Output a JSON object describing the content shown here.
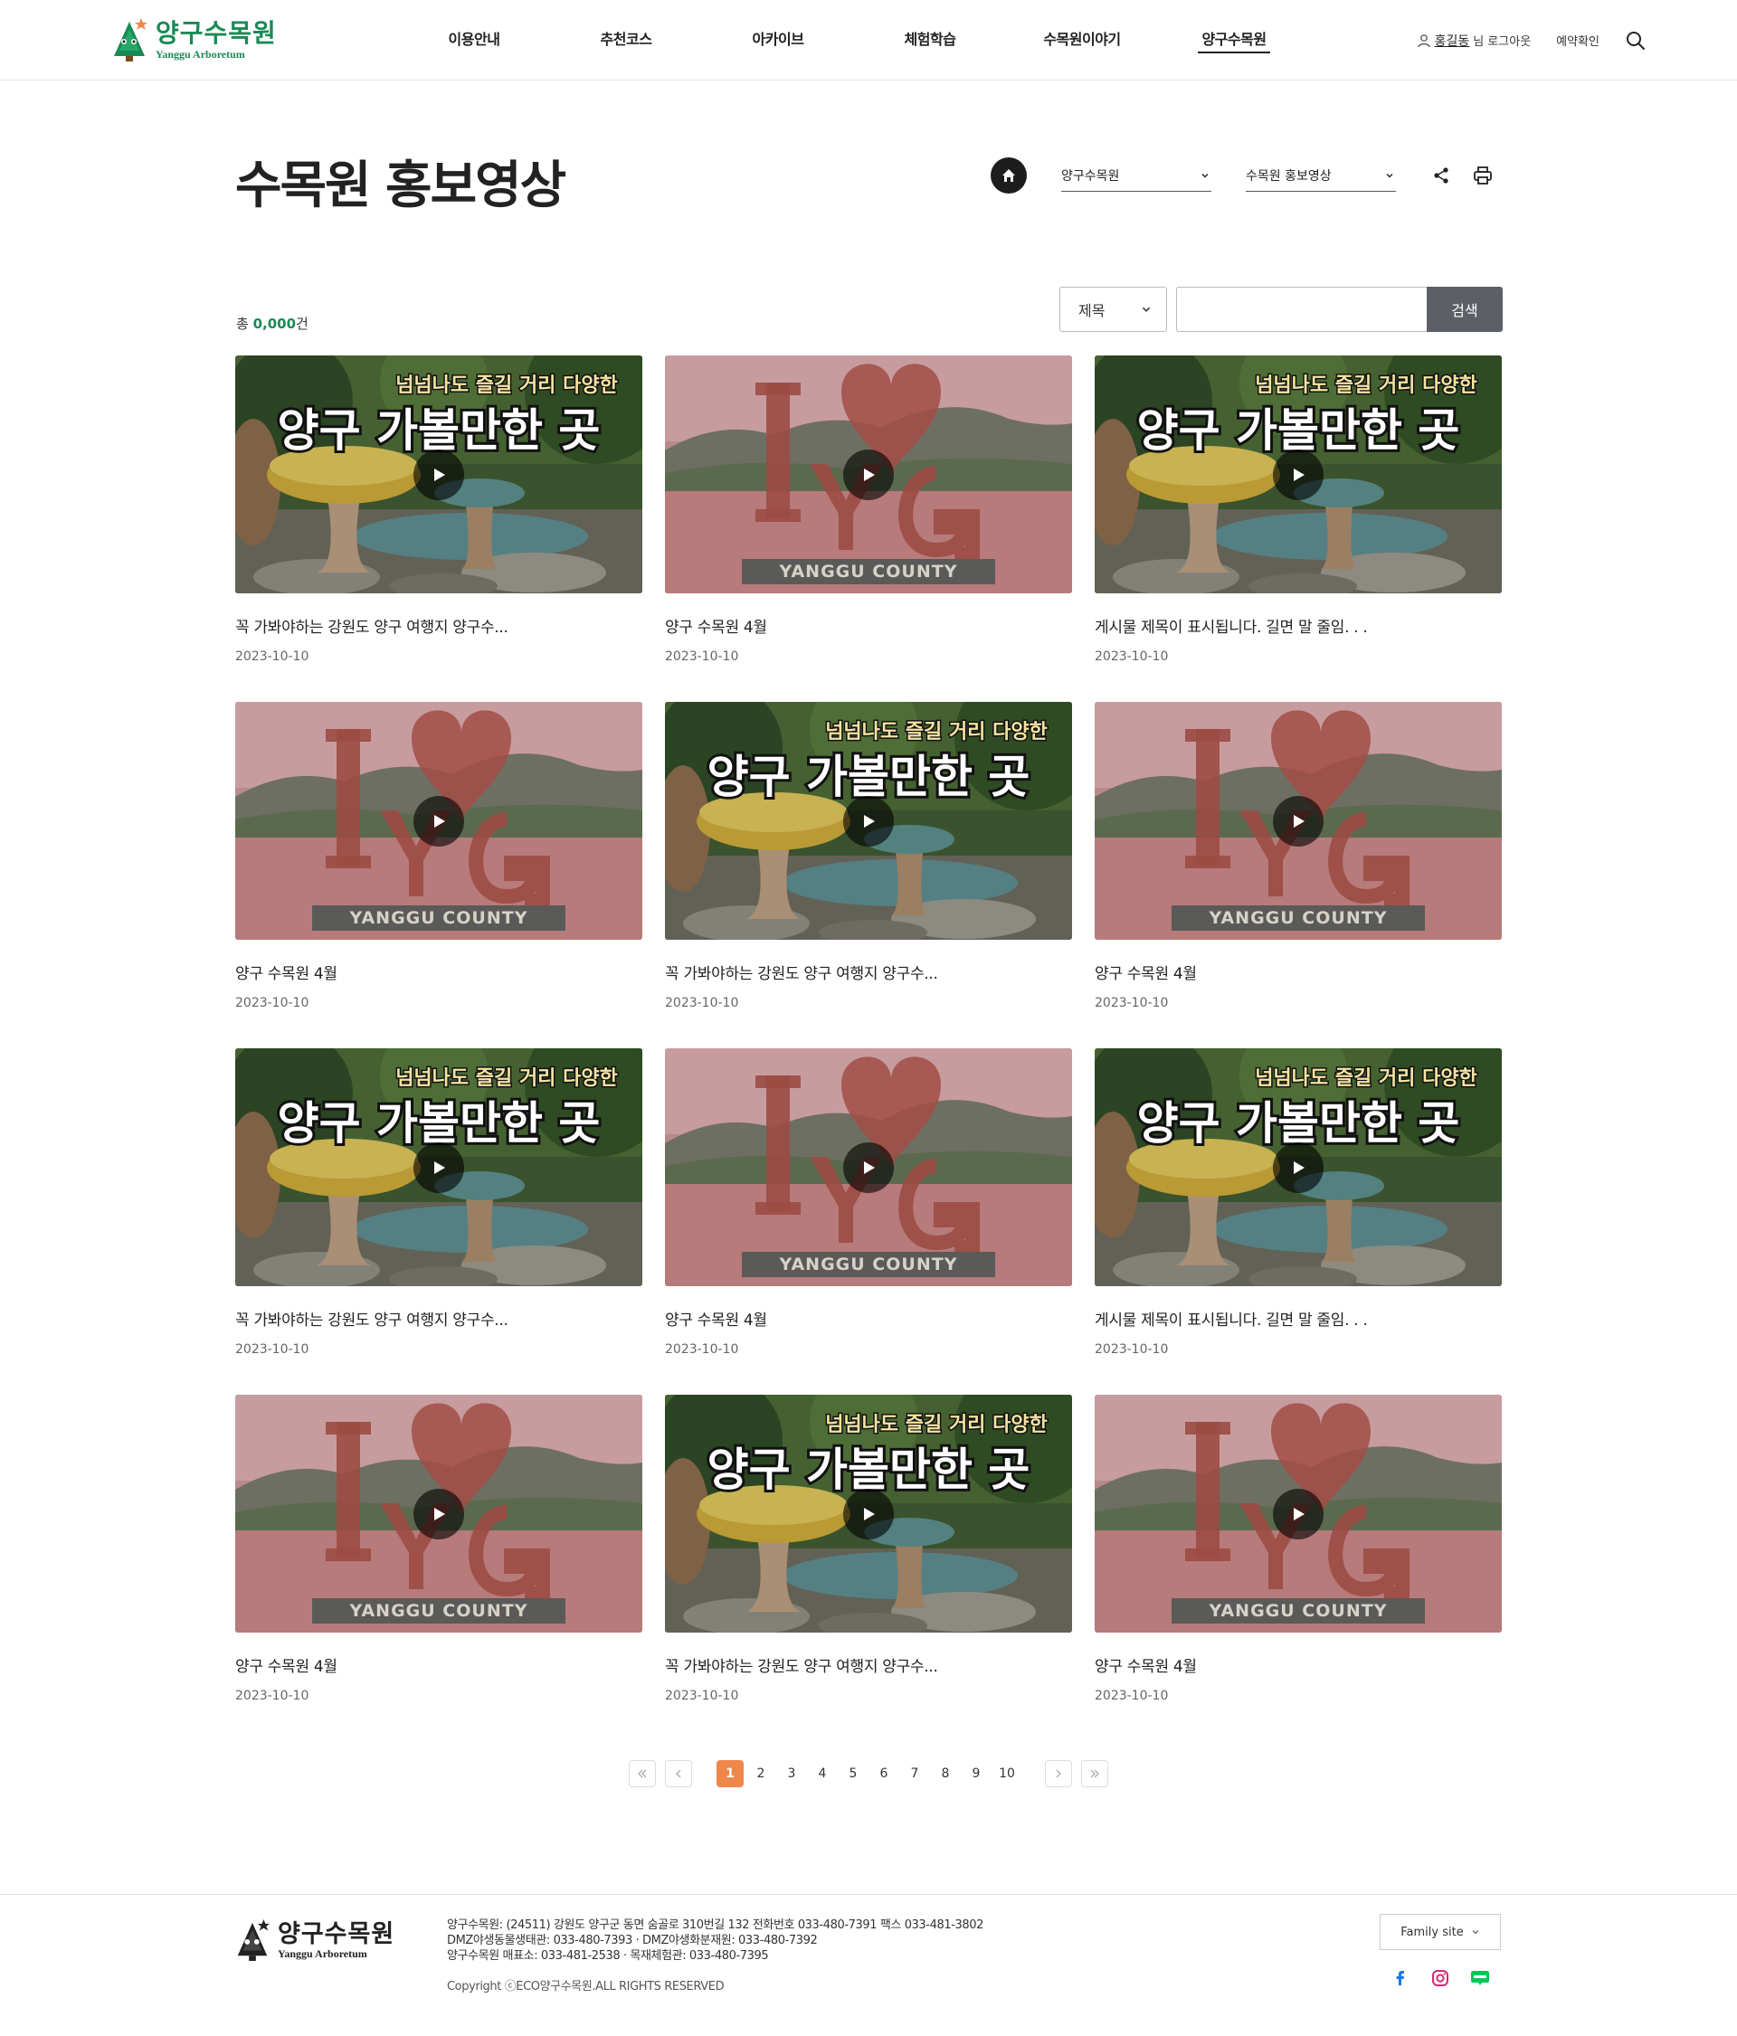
{
  "header": {
    "logo_ko": "양구수목원",
    "logo_en": "Yanggu Arboretum",
    "nav": [
      {
        "label": "이용안내",
        "active": false
      },
      {
        "label": "추천코스",
        "active": false
      },
      {
        "label": "아카이브",
        "active": false
      },
      {
        "label": "체험학습",
        "active": false
      },
      {
        "label": "수목원이야기",
        "active": false
      },
      {
        "label": "양구수목원",
        "active": true
      }
    ],
    "user_name": "홍길동",
    "user_suffix": "님 로그아웃",
    "reservation": "예약확인",
    "icons": {
      "user": "user-icon",
      "search": "search-icon"
    }
  },
  "page": {
    "title": "수목원 홍보영상",
    "breadcrumb": {
      "depth1": "양구수목원",
      "depth2": "수목원 홍보영상"
    },
    "icons": {
      "home": "home-icon",
      "share": "share-icon",
      "print": "print-icon"
    }
  },
  "board": {
    "total_prefix": "총 ",
    "total_count": "0,000",
    "total_suffix": "건",
    "search": {
      "field": "제목",
      "input_value": "",
      "button": "검색"
    },
    "items": [
      {
        "title": "꼭 가봐야하는 강원도 양구 여행지 양구수...",
        "date": "2023-10-10",
        "thumb": "mushroom"
      },
      {
        "title": "양구 수목원 4월",
        "date": "2023-10-10",
        "thumb": "yg"
      },
      {
        "title": "게시물 제목이 표시됩니다. 길면  말 줄임. . .",
        "date": "2023-10-10",
        "thumb": "mushroom"
      },
      {
        "title": "양구 수목원 4월",
        "date": "2023-10-10",
        "thumb": "yg"
      },
      {
        "title": "꼭 가봐야하는 강원도 양구 여행지 양구수...",
        "date": "2023-10-10",
        "thumb": "mushroom"
      },
      {
        "title": "양구 수목원 4월",
        "date": "2023-10-10",
        "thumb": "yg"
      },
      {
        "title": "꼭 가봐야하는 강원도 양구 여행지 양구수...",
        "date": "2023-10-10",
        "thumb": "mushroom"
      },
      {
        "title": "양구 수목원 4월",
        "date": "2023-10-10",
        "thumb": "yg"
      },
      {
        "title": "게시물 제목이 표시됩니다. 길면  말 줄임. . .",
        "date": "2023-10-10",
        "thumb": "mushroom"
      },
      {
        "title": "양구 수목원 4월",
        "date": "2023-10-10",
        "thumb": "yg"
      },
      {
        "title": "꼭 가봐야하는 강원도 양구 여행지 양구수...",
        "date": "2023-10-10",
        "thumb": "mushroom"
      },
      {
        "title": "양구 수목원 4월",
        "date": "2023-10-10",
        "thumb": "yg"
      }
    ],
    "thumb_texts": {
      "mushroom_top": "넘넘나도 즐길 거리 다양한",
      "mushroom_main": "양구 가볼만한 곳",
      "yg_sign": "YANGGU COUNTY"
    }
  },
  "pagination": {
    "pages": [
      "1",
      "2",
      "3",
      "4",
      "5",
      "6",
      "7",
      "8",
      "9",
      "10"
    ],
    "current": "1",
    "icons": {
      "first": "double-chevron-left-icon",
      "prev": "chevron-left-icon",
      "next": "chevron-right-icon",
      "last": "double-chevron-right-icon"
    }
  },
  "footer": {
    "logo_ko": "양구수목원",
    "logo_en": "Yanggu Arboretum",
    "info_lines": [
      "양구수목원: (24511) 강원도 양구군 동면 숨골로 310번길 132 전화번호 033-480-7391 팩스 033-481-3802",
      "DMZ야생동물생태관: 033-480-7393 · DMZ야생화분재원: 033-480-7392",
      "양구수목원 매표소: 033-481-2538 · 목재체험관: 033-480-7395"
    ],
    "copyright": "Copyright ⓒECO양구수목원.ALL RIGHTS RESERVED",
    "family_site": "Family site",
    "sns": [
      "facebook-icon",
      "instagram-icon",
      "blog-icon"
    ]
  },
  "colors": {
    "brand_green": "#1a8a55",
    "active_page": "#f0874a",
    "search_button": "#5c6066"
  }
}
